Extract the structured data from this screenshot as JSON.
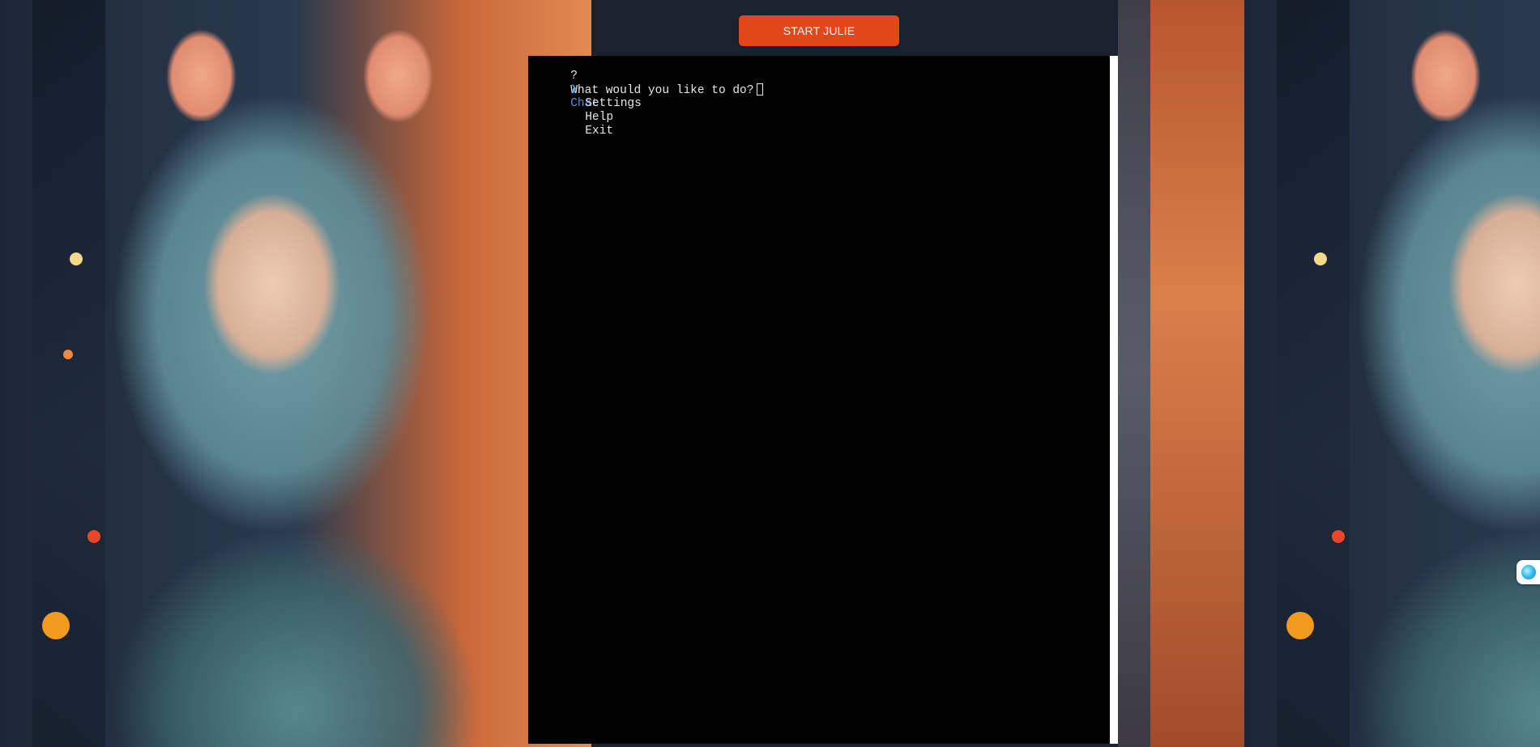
{
  "header": {
    "start_button_label": "START JULIE"
  },
  "terminal": {
    "prompt_mark": "?",
    "question": "What would you like to do?",
    "pointer_glyph": "❯",
    "menu_items": [
      {
        "label": "Chat",
        "selected": true
      },
      {
        "label": "Settings",
        "selected": false
      },
      {
        "label": "Help",
        "selected": false
      },
      {
        "label": "Exit",
        "selected": false
      }
    ]
  },
  "side_widget": {
    "icon": "assistant-orb-icon"
  },
  "colors": {
    "accent_button": "#e3461b",
    "terminal_bg": "#000000",
    "terminal_text": "#e8e8e8",
    "selection": "#4a8fe0"
  }
}
